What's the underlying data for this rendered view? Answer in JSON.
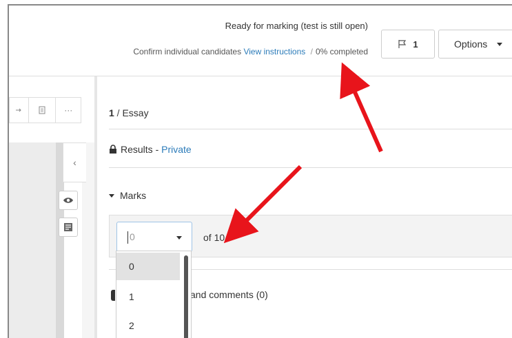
{
  "header": {
    "status": "Ready for marking (test is still open)",
    "confirm_text": "Confirm individual candidates",
    "view_instructions": "View instructions",
    "separator": "/",
    "completed": "0% completed",
    "flag_count": "1",
    "options_label": "Options"
  },
  "toolbar": {
    "icons": [
      "arrow-icon",
      "document-icon",
      "more-icon"
    ],
    "more": "···"
  },
  "collapse": "‹",
  "question": {
    "number": "1",
    "separator": " / ",
    "type": "Essay"
  },
  "results": {
    "label": "Results",
    "separator": " - ",
    "visibility": "Private"
  },
  "marks": {
    "label": "Marks",
    "input_value": "0",
    "of_label": "of 10",
    "options": [
      "0",
      "1",
      "2"
    ],
    "selected": "0"
  },
  "comments": {
    "label": "and comments (0)"
  },
  "colors": {
    "link": "#2b7bb9",
    "annotation_arrow": "#e8141b"
  }
}
